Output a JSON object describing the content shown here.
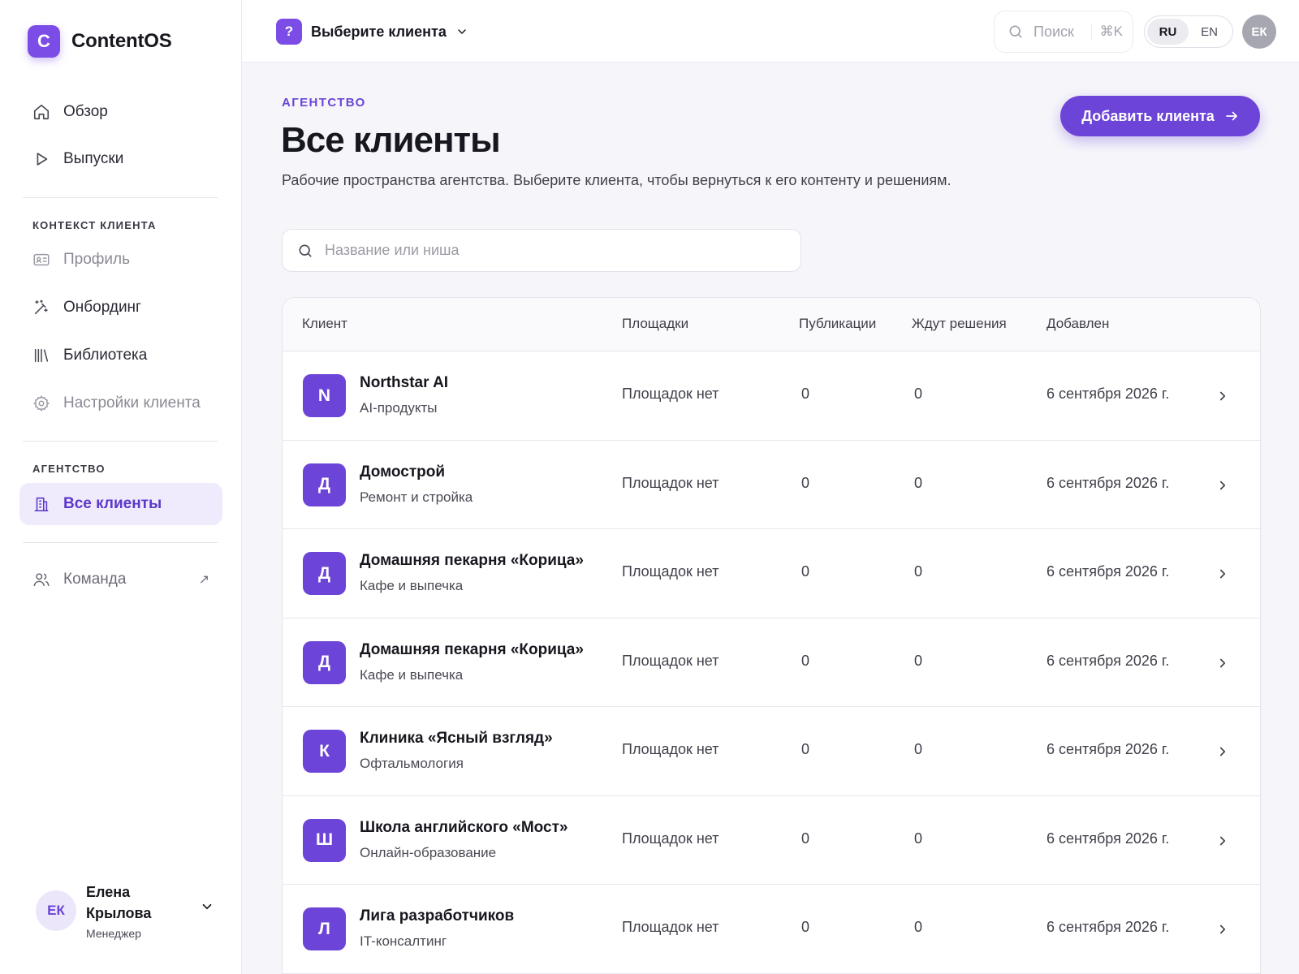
{
  "app": {
    "brand_letter": "C",
    "brand_name": "ContentOS",
    "accent": "#6c44d8"
  },
  "sidebar": {
    "top_items": [
      {
        "label": "Обзор",
        "icon": "home-icon"
      },
      {
        "label": "Выпуски",
        "icon": "play-icon"
      }
    ],
    "client_context_label": "КОНТЕКСТ КЛИЕНТА",
    "client_items": [
      {
        "label": "Профиль",
        "icon": "id-card-icon",
        "state": "disabled"
      },
      {
        "label": "Онбординг",
        "icon": "magic-wand-icon",
        "state": "enabled"
      },
      {
        "label": "Библиотека",
        "icon": "library-icon",
        "state": "enabled"
      },
      {
        "label": "Настройки клиента",
        "icon": "gear-icon",
        "state": "disabled"
      }
    ],
    "agency_label": "АГЕНТСТВО",
    "agency_items": [
      {
        "label": "Все клиенты",
        "icon": "building-icon",
        "state": "active"
      }
    ],
    "team": {
      "label": "Команда",
      "icon": "users-icon",
      "external_glyph": "↗"
    },
    "user": {
      "initials": "ЕК",
      "name": "Елена Крылова",
      "role": "Менеджер"
    }
  },
  "topbar": {
    "client_badge": "?",
    "client_picker_label": "Выберите клиента",
    "search_placeholder": "Поиск",
    "search_shortcut": "⌘K",
    "languages": [
      "RU",
      "EN"
    ],
    "active_language": "RU",
    "avatar_initials": "ЕК"
  },
  "main": {
    "kicker": "АГЕНТСТВО",
    "title": "Все клиенты",
    "subtitle": "Рабочие пространства агентства. Выберите клиента, чтобы вернуться к его контенту и решениям.",
    "add_button": "Добавить клиента",
    "filter_placeholder": "Название или ниша"
  },
  "table": {
    "columns": [
      "Клиент",
      "Площадки",
      "Публикации",
      "Ждут решения",
      "Добавлен"
    ],
    "rows": [
      {
        "initial": "N",
        "name": "Northstar AI",
        "niche": "AI-продукты",
        "platforms": "Площадок нет",
        "publications": "0",
        "pending": "0",
        "added": "6 сентября 2026 г."
      },
      {
        "initial": "Д",
        "name": "Домострой",
        "niche": "Ремонт и стройка",
        "platforms": "Площадок нет",
        "publications": "0",
        "pending": "0",
        "added": "6 сентября 2026 г."
      },
      {
        "initial": "Д",
        "name": "Домашняя пекарня «Корица»",
        "niche": "Кафе и выпечка",
        "platforms": "Площадок нет",
        "publications": "0",
        "pending": "0",
        "added": "6 сентября 2026 г."
      },
      {
        "initial": "Д",
        "name": "Домашняя пекарня «Корица»",
        "niche": "Кафе и выпечка",
        "platforms": "Площадок нет",
        "publications": "0",
        "pending": "0",
        "added": "6 сентября 2026 г."
      },
      {
        "initial": "К",
        "name": "Клиника «Ясный взгляд»",
        "niche": "Офтальмология",
        "platforms": "Площадок нет",
        "publications": "0",
        "pending": "0",
        "added": "6 сентября 2026 г."
      },
      {
        "initial": "Ш",
        "name": "Школа английского «Мост»",
        "niche": "Онлайн-образование",
        "platforms": "Площадок нет",
        "publications": "0",
        "pending": "0",
        "added": "6 сентября 2026 г."
      },
      {
        "initial": "Л",
        "name": "Лига разработчиков",
        "niche": "IT-консалтинг",
        "platforms": "Площадок нет",
        "publications": "0",
        "pending": "0",
        "added": "6 сентября 2026 г."
      }
    ]
  }
}
